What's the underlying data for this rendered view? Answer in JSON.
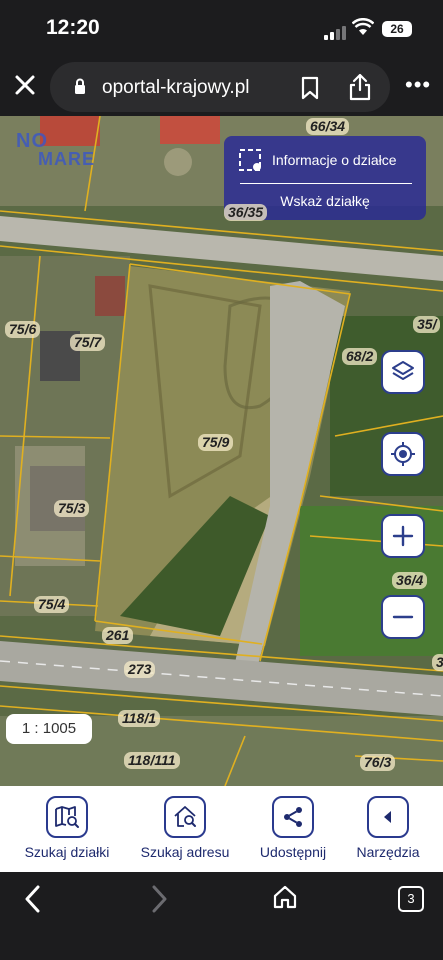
{
  "status": {
    "time": "12:20",
    "battery": "26"
  },
  "browser": {
    "url": "oportal-krajowy.pl",
    "tab_count": "3"
  },
  "map": {
    "logo_line1": "NO",
    "logo_line2": "MARE",
    "info_panel": {
      "parcel_info": "Informacje o działce",
      "show_parcel": "Wskaż działkę"
    },
    "scale": "1 : 1005",
    "parcels": [
      {
        "label": "66/34"
      },
      {
        "label": "36/35"
      },
      {
        "label": "35/"
      },
      {
        "label": "68/2"
      },
      {
        "label": "75/6"
      },
      {
        "label": "75/7"
      },
      {
        "label": "75/9"
      },
      {
        "label": "75/3"
      },
      {
        "label": "75/4"
      },
      {
        "label": "261"
      },
      {
        "label": "273"
      },
      {
        "label": "36/4"
      },
      {
        "label": "3"
      },
      {
        "label": "118/1"
      },
      {
        "label": "118/111"
      },
      {
        "label": "76/3"
      }
    ]
  },
  "toolbar": {
    "search_parcel": "Szukaj działki",
    "search_address": "Szukaj adresu",
    "share": "Udostępnij",
    "tools": "Narzędzia"
  },
  "colors": {
    "accent": "#2a3a8e",
    "panel": "#2828a0",
    "parcel_line": "#e0b020"
  }
}
